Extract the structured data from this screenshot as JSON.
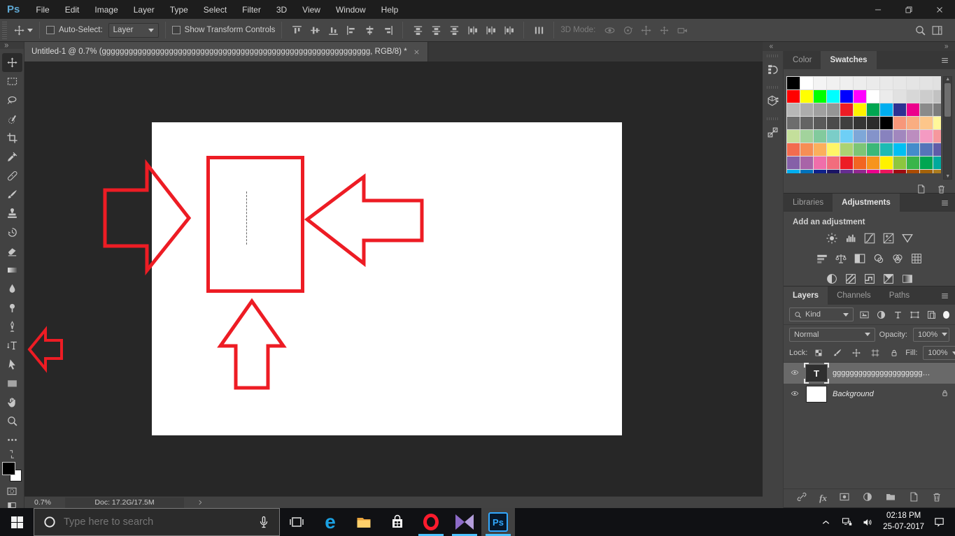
{
  "menu_bar": {
    "logo": "Ps",
    "items": [
      "File",
      "Edit",
      "Image",
      "Layer",
      "Type",
      "Select",
      "Filter",
      "3D",
      "View",
      "Window",
      "Help"
    ]
  },
  "options_bar": {
    "auto_select_label": "Auto-Select:",
    "auto_select_value": "Layer",
    "show_transform_label": "Show Transform Controls",
    "mode_3d_label": "3D Mode:",
    "align_icons": [
      "align-top-edges",
      "align-vertical-centers",
      "align-bottom-edges",
      "align-left-edges",
      "align-horizontal-centers",
      "align-right-edges"
    ],
    "distribute_icons": [
      "distribute-top-edges",
      "distribute-vertical-centers",
      "distribute-bottom-edges",
      "distribute-left-edges",
      "distribute-horizontal-centers",
      "distribute-right-edges"
    ],
    "spacing_icon": "distribute-spacing",
    "mode_3d_icons": [
      "orbit-3d",
      "roll-3d",
      "drag-3d",
      "slide-3d",
      "camera-3d"
    ]
  },
  "toolbar": {
    "tools": [
      {
        "name": "move-tool",
        "icon": "move",
        "active": true
      },
      {
        "name": "rectangular-marquee-tool",
        "icon": "rectangular-marquee",
        "active": false
      },
      {
        "name": "lasso-tool",
        "icon": "lasso",
        "active": false
      },
      {
        "name": "quick-selection-tool",
        "icon": "quick-selection",
        "active": false
      },
      {
        "name": "crop-tool",
        "icon": "crop",
        "active": false
      },
      {
        "name": "eyedropper-tool",
        "icon": "eyedropper",
        "active": false
      },
      {
        "name": "spot-healing-brush-tool",
        "icon": "spot-healing",
        "active": false
      },
      {
        "name": "brush-tool",
        "icon": "brush",
        "active": false
      },
      {
        "name": "clone-stamp-tool",
        "icon": "clone-stamp",
        "active": false
      },
      {
        "name": "history-brush-tool",
        "icon": "history-brush",
        "active": false
      },
      {
        "name": "eraser-tool",
        "icon": "eraser",
        "active": false
      },
      {
        "name": "gradient-tool",
        "icon": "gradient",
        "active": false
      },
      {
        "name": "blur-tool",
        "icon": "blur",
        "active": false
      },
      {
        "name": "dodge-tool",
        "icon": "dodge",
        "active": false
      },
      {
        "name": "pen-tool",
        "icon": "pen",
        "active": false
      },
      {
        "name": "type-tool",
        "icon": "type",
        "active": false
      },
      {
        "name": "path-selection-tool",
        "icon": "path-selection",
        "active": false
      },
      {
        "name": "rectangle-tool",
        "icon": "rectangle",
        "active": false
      },
      {
        "name": "hand-tool",
        "icon": "hand",
        "active": false
      },
      {
        "name": "zoom-tool",
        "icon": "zoom",
        "active": false
      },
      {
        "name": "edit-toolbar",
        "icon": "ellipsis",
        "active": false
      }
    ]
  },
  "document": {
    "tab_title": "Untitled-1 @ 0.7% (gggggggggggggggggggggggggggggggggggggggggggggggggggggggggggg, RGB/8) *",
    "status": {
      "zoom": "0.7%",
      "doc": "Doc: 17.2G/17.5M"
    }
  },
  "panels": {
    "strip_icons": [
      "history-panel",
      "properties-panel",
      "info-panel"
    ],
    "swatches": {
      "tabs": [
        "Color",
        "Swatches"
      ],
      "active_tab": "Swatches",
      "action_icons": [
        "new-item",
        "trash"
      ],
      "rows": [
        [
          "#000000",
          "#ffffff",
          "#f4f4f4",
          "#f1f1f1",
          "#efefef",
          "#ededed",
          "#ebebeb",
          "#e9e9e9",
          "#e7e7e7",
          "#e5e5e5",
          "#e3e3e3",
          "#e1e1e1"
        ],
        [
          "#ff0000",
          "#ffff00",
          "#00ff00",
          "#00ffff",
          "#0000ff",
          "#ff00ff",
          "#ffffff",
          "#ebebeb",
          "#e1e1e1",
          "#d7d7d7",
          "#cccccc",
          "#c2c2c2"
        ],
        [
          "#b7b7b7",
          "#acacac",
          "#a0a0a0",
          "#959595",
          "#ed1c24",
          "#fff200",
          "#00a651",
          "#00aeef",
          "#2e3192",
          "#ec008c",
          "#8a8a8a",
          "#7d7d7d"
        ],
        [
          "#6d6d6d",
          "#646464",
          "#5a5a5a",
          "#4b4b4b",
          "#3f3f3f",
          "#353535",
          "#2b2b2b",
          "#000000",
          "#f7977a",
          "#f9ad81",
          "#fdc68a",
          "#fff79a"
        ],
        [
          "#c4df9b",
          "#a2d39c",
          "#82ca9d",
          "#7bcdc8",
          "#6ecff6",
          "#7ea7d8",
          "#8493ca",
          "#8882be",
          "#a187be",
          "#bc8dbf",
          "#f49ac2",
          "#f6989d"
        ],
        [
          "#f26c4f",
          "#f68e55",
          "#fbaf5c",
          "#fff567",
          "#acd372",
          "#7cc576",
          "#3bb878",
          "#1cbbb4",
          "#00bff3",
          "#448ccb",
          "#5574b9",
          "#605ca8"
        ],
        [
          "#8560a8",
          "#a864a8",
          "#f06eaa",
          "#f26d7d",
          "#ed1c24",
          "#f26522",
          "#f7941d",
          "#fff200",
          "#8dc63f",
          "#39b54a",
          "#00a651",
          "#00a99d"
        ],
        [
          "#00aeef",
          "#0072bc",
          "#0f218b",
          "#1b1464",
          "#662d91",
          "#92278f",
          "#ec008c",
          "#ed145b",
          "#9e0b0f",
          "#aa4b00",
          "#a36209",
          "#ab7c1e"
        ]
      ]
    },
    "adjustments": {
      "tabs": [
        "Libraries",
        "Adjustments"
      ],
      "active_tab": "Adjustments",
      "heading": "Add an adjustment",
      "icon_rows": [
        [
          "brightness-contrast",
          "levels",
          "curves",
          "exposure",
          "vibrance"
        ],
        [
          "hue-saturation",
          "color-balance",
          "black-white",
          "photo-filter",
          "channel-mixer",
          "color-lookup"
        ],
        [
          "invert",
          "posterize",
          "threshold",
          "selective-color",
          "gradient-map"
        ]
      ]
    },
    "layers": {
      "tabs": [
        "Layers",
        "Channels",
        "Paths"
      ],
      "active_tab": "Layers",
      "filter_label": "Kind",
      "filter_icons": [
        "pixel-filter",
        "adjustment-filter",
        "type-filter",
        "shape-filter",
        "smart-filter"
      ],
      "blend_mode": "Normal",
      "opacity_label": "Opacity:",
      "opacity_value": "100%",
      "lock_label": "Lock:",
      "lock_icons": [
        "transparency-lock",
        "brush-lock",
        "move-lock",
        "artboard-lock",
        "padlock"
      ],
      "fill_label": "Fill:",
      "fill_value": "100%",
      "fx_label": "fx",
      "action_icons": [
        "link",
        "fx",
        "layer-mask",
        "adjustment-layer",
        "group-folder",
        "new-item",
        "trash"
      ],
      "items": [
        {
          "type": "text",
          "name": "ggggggggggggggggggggggg...",
          "selected": true,
          "locked": false
        },
        {
          "type": "background",
          "name": "Background",
          "selected": false,
          "locked": true
        }
      ]
    }
  },
  "taskbar": {
    "search_placeholder": "Type here to search",
    "apps": [
      {
        "name": "edge",
        "glyph": "e",
        "running": false,
        "active": false
      },
      {
        "name": "file-explorer",
        "running": false,
        "active": false
      },
      {
        "name": "store",
        "running": false,
        "active": false
      },
      {
        "name": "opera",
        "running": true,
        "active": false
      },
      {
        "name": "kmplayer",
        "running": true,
        "active": false
      },
      {
        "name": "photoshop",
        "glyph": "Ps",
        "running": true,
        "active": true
      }
    ],
    "clock": {
      "time": "02:18 PM",
      "date": "25-07-2017"
    }
  }
}
